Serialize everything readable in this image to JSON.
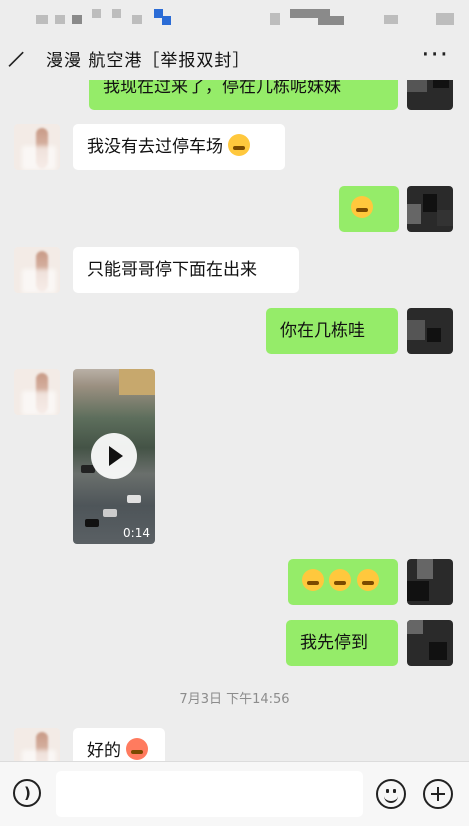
{
  "header": {
    "title": "漫漫   航空港［举报双封］"
  },
  "messages": {
    "m1": "我现在过来了，停在几栋呢妹妹",
    "m2": "我没有去过停车场",
    "m4": "只能哥哥停下面在出来",
    "m5": "你在几栋哇",
    "m8": "我先停到",
    "m9": "好的"
  },
  "video": {
    "duration": "0:14"
  },
  "timestamp": "7月3日 下午14:56",
  "icons": {
    "back": "back-arrow-icon",
    "more": "more-icon",
    "play": "play-icon",
    "voice": "voice-icon",
    "emoji": "emoji-icon",
    "plus": "plus-icon"
  },
  "colors": {
    "outgoing_bubble": "#95ec69",
    "incoming_bubble": "#ffffff",
    "background": "#ededed"
  }
}
